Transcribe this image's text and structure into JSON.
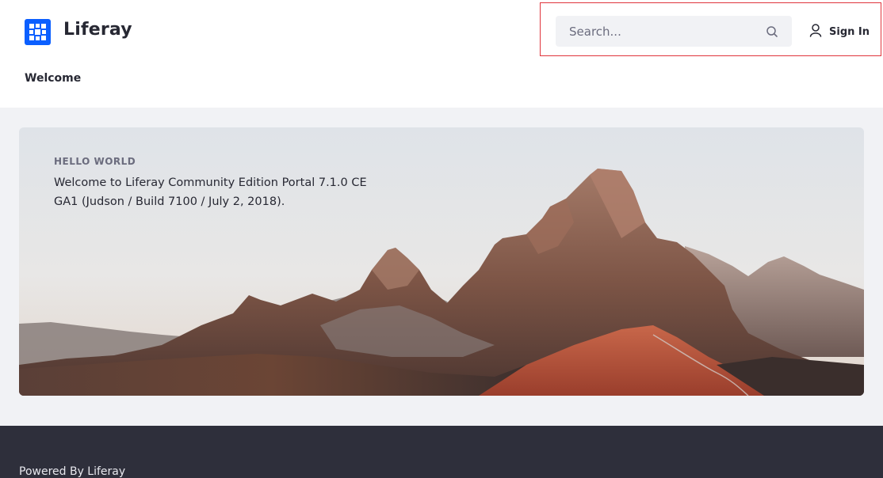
{
  "header": {
    "brand": "Liferay",
    "nav": {
      "welcome_label": "Welcome"
    },
    "search": {
      "placeholder": "Search..."
    },
    "signin_label": "Sign In"
  },
  "banner": {
    "eyebrow": "HELLO WORLD",
    "text": "Welcome to Liferay Community Edition Portal 7.1.0 CE GA1 (Judson / Build 7100 / July 2, 2018)."
  },
  "footer": {
    "text": "Powered By Liferay"
  },
  "icons": {
    "logo": "liferay-logo-icon",
    "search": "search-icon",
    "signin": "user-icon"
  },
  "colors": {
    "brand": "#0b5fff",
    "page_bg": "#f1f2f5",
    "footer_bg": "#2e2f3b",
    "highlight": "#e0343c"
  }
}
